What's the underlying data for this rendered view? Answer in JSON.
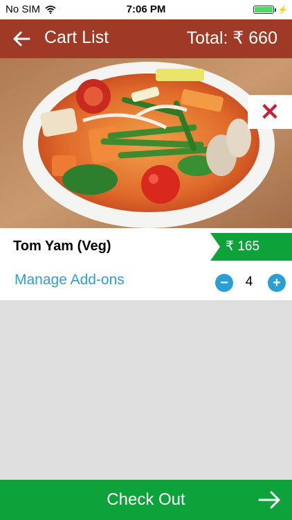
{
  "status_bar": {
    "carrier": "No SIM",
    "time": "7:06 PM"
  },
  "header": {
    "title": "Cart List",
    "total_label": "Total:",
    "total_amount": "₹ 660"
  },
  "cart": {
    "items": [
      {
        "name": "Tom Yam (Veg)",
        "price": "₹ 165",
        "addons_label": "Manage Add-ons",
        "quantity": "4"
      }
    ]
  },
  "footer": {
    "checkout_label": "Check Out"
  },
  "colors": {
    "header": "#9e3a25",
    "price_tag": "#0da33a",
    "checkout": "#0da33a",
    "link": "#2a9fd6",
    "remove": "#c2243f"
  },
  "icons": {
    "back": "arrow-left-icon",
    "remove": "close-icon",
    "minus": "minus-icon",
    "plus": "plus-icon",
    "checkout": "arrow-right-icon"
  }
}
